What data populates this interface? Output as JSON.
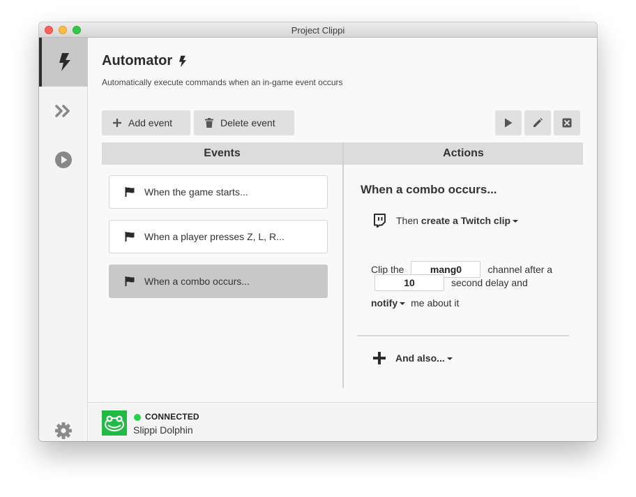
{
  "window": {
    "title": "Project Clippi"
  },
  "colors": {
    "accent": "#21ba45",
    "connected": "#21d44a",
    "selected_bg": "#c8c8c8"
  },
  "sidebar": {
    "items": [
      {
        "icon": "lightning-icon",
        "active": true
      },
      {
        "icon": "double-chevron-right-icon",
        "active": false
      },
      {
        "icon": "play-circle-icon",
        "active": false
      }
    ],
    "settings_icon": "gear-icon"
  },
  "header": {
    "title": "Automator",
    "subtitle": "Automatically execute commands when an in-game event occurs"
  },
  "toolbar": {
    "add_label": "Add event",
    "delete_label": "Delete event",
    "icons": [
      "play-icon",
      "pencil-icon",
      "close-box-icon"
    ]
  },
  "events": {
    "header": "Events",
    "items": [
      {
        "label": "When the game starts..."
      },
      {
        "label": "When a player presses Z, L, R..."
      },
      {
        "label": "When a combo occurs..."
      }
    ],
    "selected_index": 2
  },
  "actions": {
    "header": "Actions",
    "title": "When a combo occurs...",
    "then_prefix": "Then",
    "then_action": "create a Twitch clip",
    "clip_the": "Clip the",
    "channel_value": "mang0",
    "channel_after": "channel after a",
    "delay_value": "10",
    "delay_suffix": "second delay and",
    "notify_label": "notify",
    "notify_suffix": "me about it",
    "and_also": "And also..."
  },
  "status": {
    "state": "CONNECTED",
    "source": "Slippi Dolphin"
  }
}
